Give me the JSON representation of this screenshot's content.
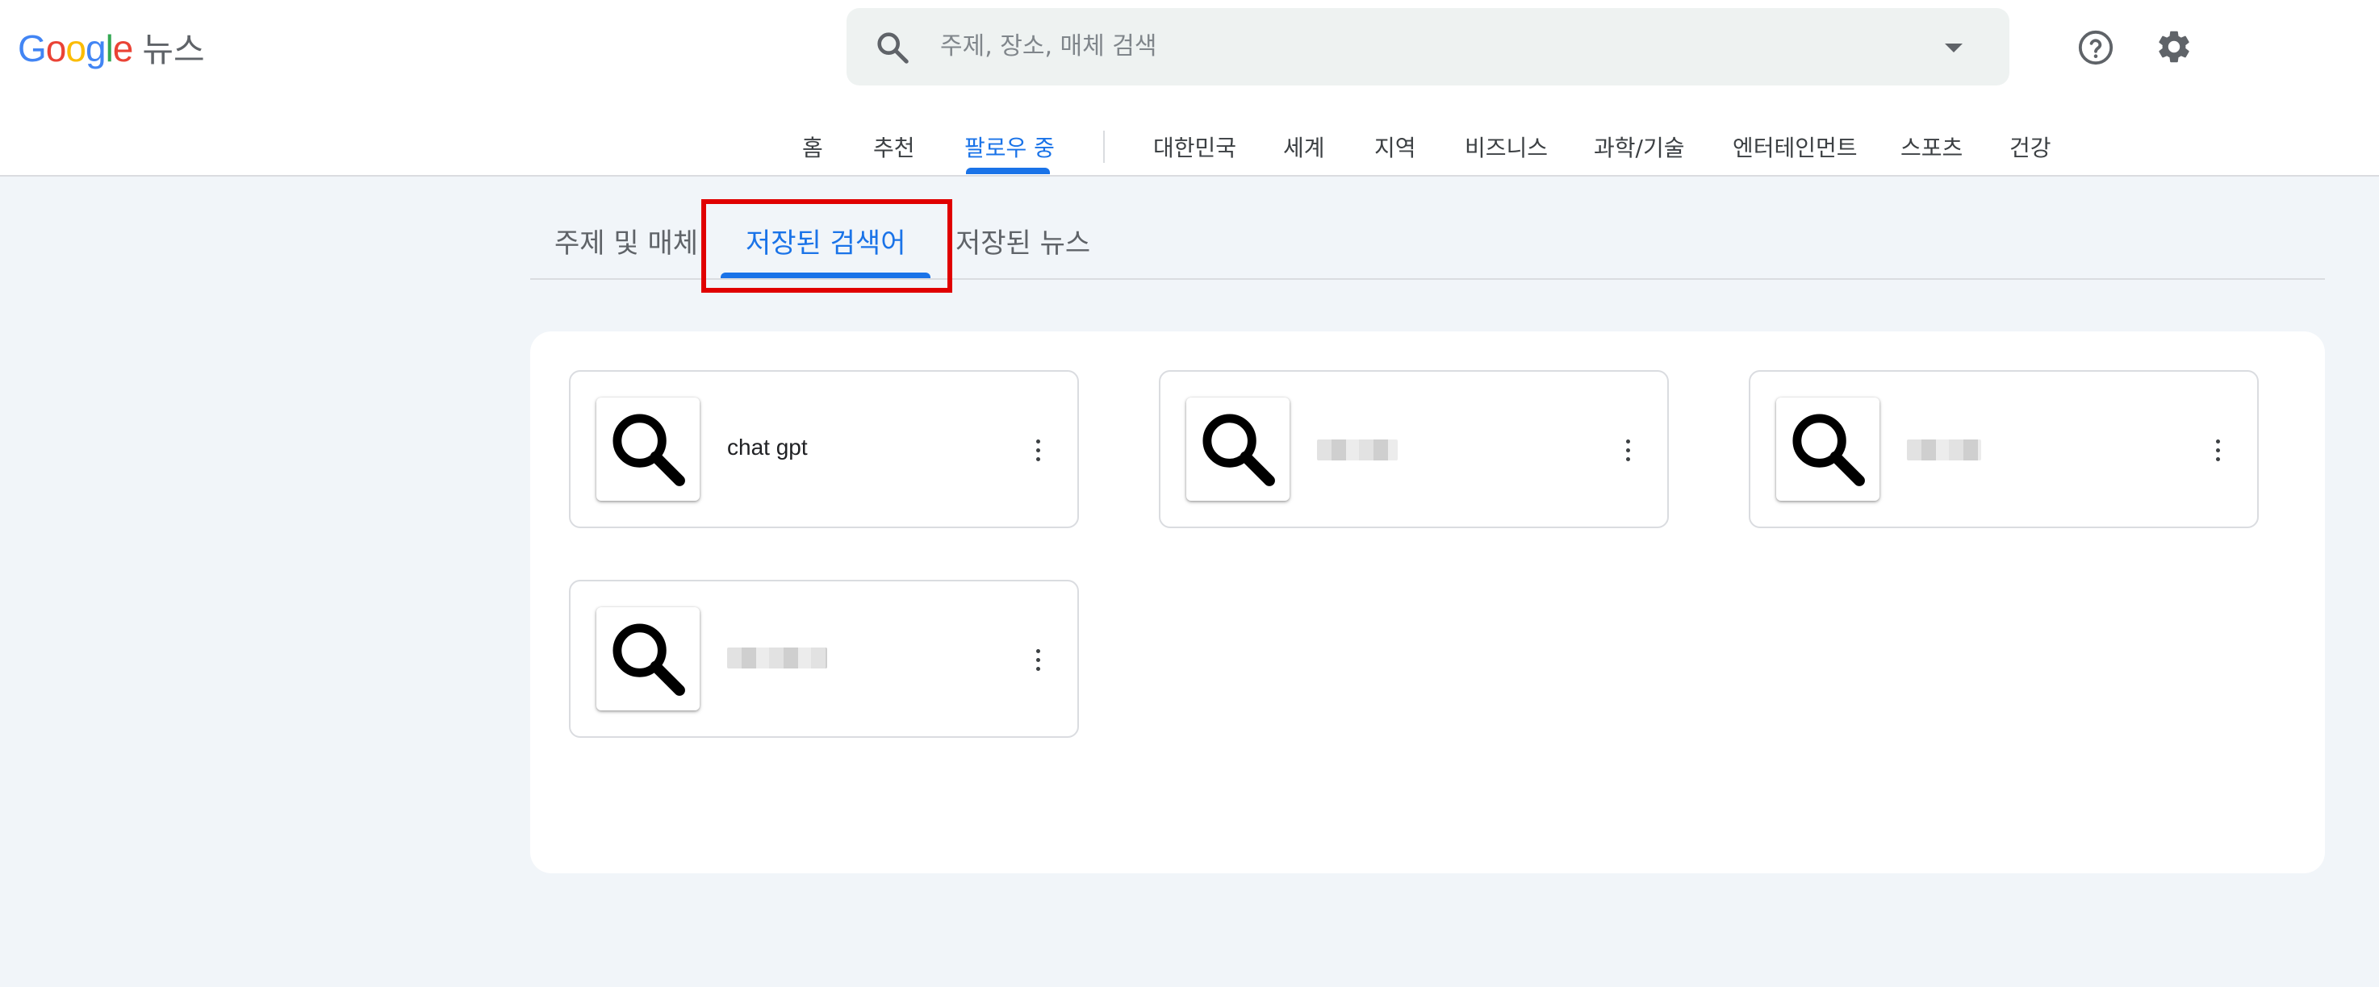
{
  "brand": {
    "logo_letters": [
      "G",
      "o",
      "o",
      "g",
      "l",
      "e"
    ],
    "logo_colors": [
      "#4285F4",
      "#EA4335",
      "#FBBC05",
      "#4285F4",
      "#34A853",
      "#EA4335"
    ],
    "product": "뉴스"
  },
  "search": {
    "placeholder": "주제, 장소, 매체 검색",
    "icon": "search-icon"
  },
  "header_icons": {
    "help": "help-circle-icon",
    "settings": "gear-icon"
  },
  "nav": {
    "items": [
      {
        "label": "홈"
      },
      {
        "label": "추천"
      },
      {
        "label": "팔로우 중",
        "active": true
      },
      {
        "label": "대한민국"
      },
      {
        "label": "세계"
      },
      {
        "label": "지역"
      },
      {
        "label": "비즈니스"
      },
      {
        "label": "과학/기술"
      },
      {
        "label": "엔터테인먼트"
      },
      {
        "label": "스포츠"
      },
      {
        "label": "건강"
      }
    ],
    "accent_color": "#1a73e8"
  },
  "subtabs": {
    "items": [
      {
        "label": "주제 및 매체"
      },
      {
        "label": "저장된 검색어",
        "active": true
      },
      {
        "label": "저장된 뉴스"
      }
    ]
  },
  "saved_searches": [
    {
      "label": "chat gpt",
      "redacted": false
    },
    {
      "label": "",
      "redacted": true
    },
    {
      "label": "",
      "redacted": true
    },
    {
      "label": "",
      "redacted": true
    }
  ]
}
